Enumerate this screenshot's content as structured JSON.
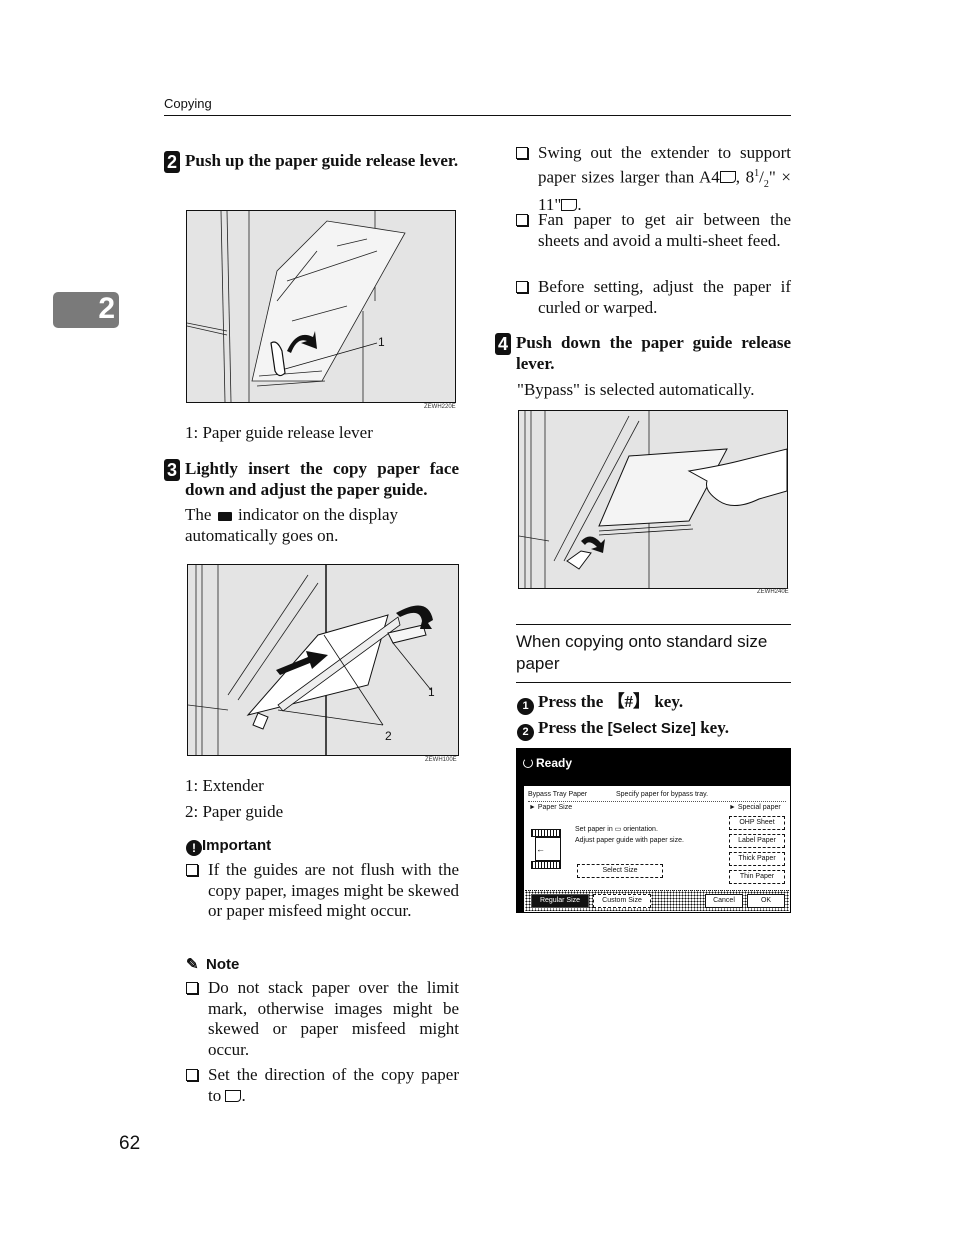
{
  "header": {
    "section": "Copying"
  },
  "chapter_tab": "2",
  "page_number": "62",
  "left_column": {
    "step2": {
      "number": "2",
      "text": "Push up the paper guide release lever.",
      "figure_code": "ZEWH220E",
      "callout": "1",
      "caption": "1: Paper guide release lever"
    },
    "step3": {
      "number": "3",
      "text": "Lightly insert the copy paper face down and adjust the paper guide.",
      "body_before": "The",
      "body_after": "indicator on the display automatically goes on.",
      "figure_code": "ZEWH100E",
      "callouts": [
        "1",
        "2"
      ],
      "captions": [
        "1: Extender",
        "2: Paper guide"
      ]
    },
    "important": {
      "heading": "Important",
      "items": [
        "If the guides are not flush with the copy paper, images might be skewed or paper misfeed might occur."
      ]
    },
    "note": {
      "heading": "Note",
      "items": [
        "Do not stack paper over the limit mark, otherwise images might be skewed or paper misfeed might occur.",
        "Set the direction of the copy paper to"
      ],
      "item2_suffix": "."
    }
  },
  "right_column": {
    "bullets": [
      "Swing out the extender to support paper sizes larger than A4",
      "Fan paper to get air between the sheets and avoid a multi-sheet feed.",
      "Before setting, adjust the paper if curled or warped."
    ],
    "bullet1_sizes": {
      "a": ", 8",
      "sup": "1",
      "slash": "/",
      "sub": "2",
      "rest": "\" × 11\"",
      "end": "."
    },
    "step4": {
      "number": "4",
      "text": "Push down the paper guide release lever.",
      "body": "\"Bypass\" is selected automatically.",
      "figure_code": "ZEWH240E"
    },
    "subsection": {
      "title": "When copying onto standard size paper",
      "substeps": [
        {
          "num": "1",
          "pre": "Press the ",
          "key": "【#】",
          "post": " key."
        },
        {
          "num": "2",
          "pre": "Press the ",
          "key": "[Select Size]",
          "post": " key."
        }
      ]
    },
    "panel": {
      "status": "Ready",
      "title": "Bypass Tray Paper",
      "instruction": "Specify paper for bypass tray.",
      "paper_size_label": "► Paper Size",
      "special_paper_label": "► Special paper",
      "msg1": "Set paper in ▭ orientation.",
      "msg2": "Adjust paper guide with paper size.",
      "select_size": "Select Size",
      "special_buttons": [
        "OHP Sheet",
        "Label Paper",
        "Thick Paper",
        "Thin Paper"
      ],
      "tabs": [
        {
          "label": "Regular Size",
          "selected": true
        },
        {
          "label": "Custom Size",
          "selected": false
        }
      ],
      "cancel": "Cancel",
      "ok": "OK"
    }
  }
}
